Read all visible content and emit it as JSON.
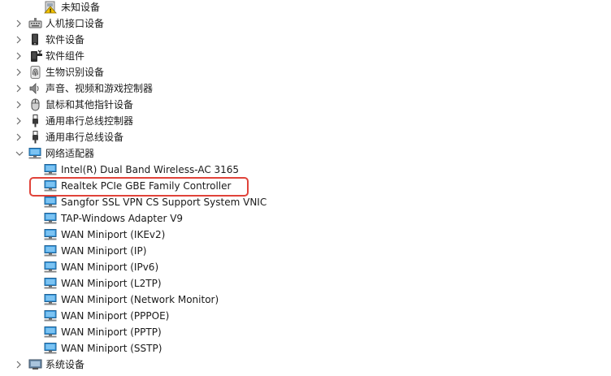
{
  "tree": {
    "items": [
      {
        "label": "未知设备",
        "icon": "unknown-device-warning-icon"
      },
      {
        "label": "人机接口设备",
        "icon": "hid-keyboard-icon"
      },
      {
        "label": "软件设备",
        "icon": "software-device-icon"
      },
      {
        "label": "软件组件",
        "icon": "software-component-icon"
      },
      {
        "label": "生物识别设备",
        "icon": "fingerprint-icon"
      },
      {
        "label": "声音、视频和游戏控制器",
        "icon": "speaker-icon"
      },
      {
        "label": "鼠标和其他指针设备",
        "icon": "mouse-icon"
      },
      {
        "label": "通用串行总线控制器",
        "icon": "usb-icon"
      },
      {
        "label": "通用串行总线设备",
        "icon": "usb-icon"
      },
      {
        "label": "网络适配器",
        "icon": "network-adapter-icon"
      },
      {
        "label": "Intel(R) Dual Band Wireless-AC 3165",
        "icon": "network-adapter-icon"
      },
      {
        "label": "Realtek PCIe GBE Family Controller",
        "icon": "network-adapter-icon"
      },
      {
        "label": "Sangfor SSL VPN CS Support System VNIC",
        "icon": "network-adapter-icon"
      },
      {
        "label": "TAP-Windows Adapter V9",
        "icon": "network-adapter-icon"
      },
      {
        "label": "WAN Miniport (IKEv2)",
        "icon": "network-adapter-icon"
      },
      {
        "label": "WAN Miniport (IP)",
        "icon": "network-adapter-icon"
      },
      {
        "label": "WAN Miniport (IPv6)",
        "icon": "network-adapter-icon"
      },
      {
        "label": "WAN Miniport (L2TP)",
        "icon": "network-adapter-icon"
      },
      {
        "label": "WAN Miniport (Network Monitor)",
        "icon": "network-adapter-icon"
      },
      {
        "label": "WAN Miniport (PPPOE)",
        "icon": "network-adapter-icon"
      },
      {
        "label": "WAN Miniport (PPTP)",
        "icon": "network-adapter-icon"
      },
      {
        "label": "WAN Miniport (SSTP)",
        "icon": "network-adapter-icon"
      },
      {
        "label": "系统设备",
        "icon": "system-device-icon"
      }
    ]
  },
  "colors": {
    "highlight": "#e0433a",
    "network_icon": "#2b8fd6",
    "chevron": "#6b6b6b"
  }
}
